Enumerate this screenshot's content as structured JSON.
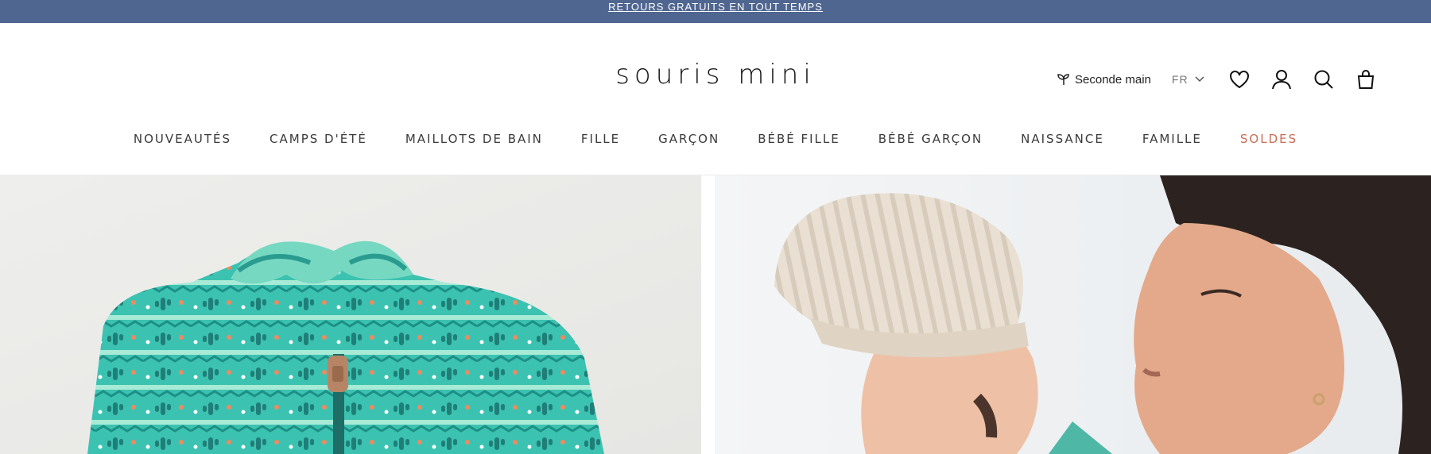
{
  "announcement": {
    "text": "RETOURS GRATUITS EN TOUT TEMPS"
  },
  "header": {
    "logo": "souris mini",
    "second_hand_label": "Seconde main",
    "language": "FR",
    "icons": [
      "sprout-icon",
      "chevron-down-icon",
      "heart-icon",
      "account-icon",
      "search-icon",
      "bag-icon"
    ]
  },
  "nav": {
    "items": [
      {
        "label": "NOUVEAUTÉS"
      },
      {
        "label": "CAMPS D'ÉTÉ"
      },
      {
        "label": "MAILLOTS DE BAIN"
      },
      {
        "label": "FILLE"
      },
      {
        "label": "GARÇON"
      },
      {
        "label": "BÉBÉ FILLE"
      },
      {
        "label": "BÉBÉ GARÇON"
      },
      {
        "label": "NAISSANCE"
      },
      {
        "label": "FAMILLE"
      },
      {
        "label": "SOLDES"
      }
    ]
  },
  "colors": {
    "announcement_bg": "#4f6690",
    "sale": "#c86d54",
    "fleece_teal": "#2fb3a6",
    "beanie": "#e6ddd0"
  },
  "hero": {
    "left_image": "teal cactus-pattern fleece jacket",
    "right_image": "mother kissing child wearing beige knit beanie"
  }
}
